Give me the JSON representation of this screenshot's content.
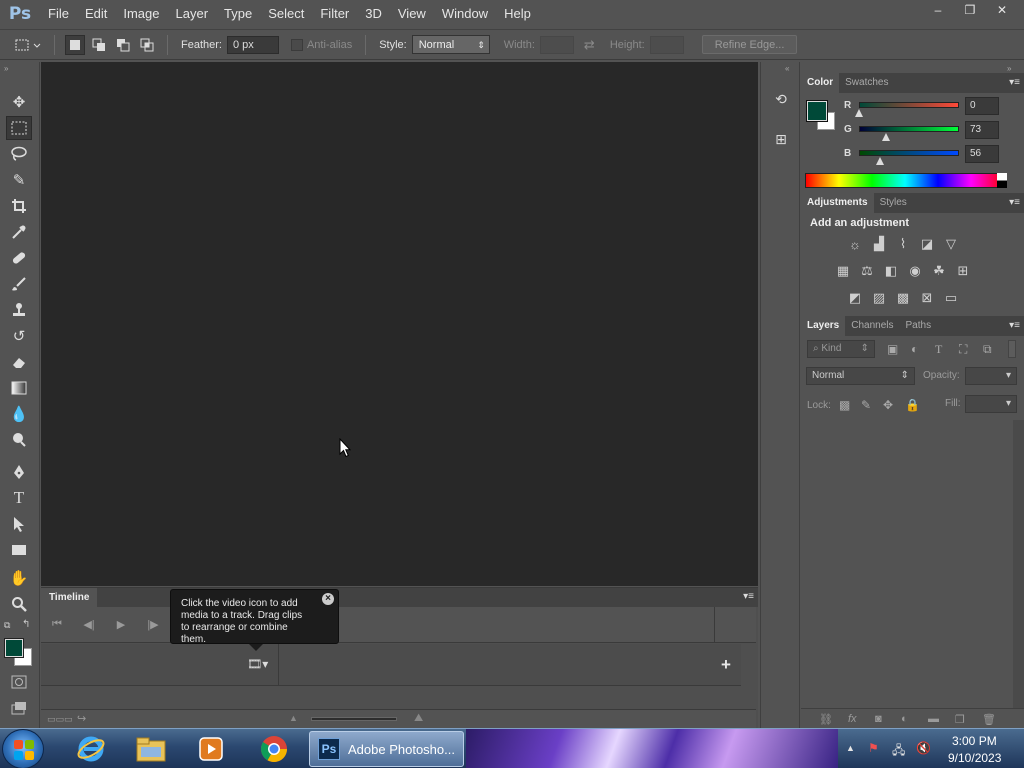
{
  "app": {
    "logo": "Ps"
  },
  "menu": [
    "File",
    "Edit",
    "Image",
    "Layer",
    "Type",
    "Select",
    "Filter",
    "3D",
    "View",
    "Window",
    "Help"
  ],
  "window_controls": {
    "minimize": "–",
    "restore": "❐",
    "close": "✕"
  },
  "options": {
    "feather_label": "Feather:",
    "feather_value": "0 px",
    "antialias_label": "Anti-alias",
    "style_label": "Style:",
    "style_value": "Normal",
    "width_label": "Width:",
    "height_label": "Height:",
    "refine_label": "Refine Edge..."
  },
  "colors": {
    "foreground": "#004938",
    "background": "#ffffff"
  },
  "timeline": {
    "tab": "Timeline",
    "tooltip": "Click the video icon to add media to a track. Drag clips to rearrange or combine them.",
    "add": "+"
  },
  "color_panel": {
    "tabs": [
      "Color",
      "Swatches"
    ],
    "r_label": "R",
    "r_value": "0",
    "g_label": "G",
    "g_value": "73",
    "b_label": "B",
    "b_value": "56"
  },
  "adjustments_panel": {
    "tabs": [
      "Adjustments",
      "Styles"
    ],
    "heading": "Add an adjustment"
  },
  "layers_panel": {
    "tabs": [
      "Layers",
      "Channels",
      "Paths"
    ],
    "kind_label": "Kind",
    "blend_mode": "Normal",
    "opacity_label": "Opacity:",
    "lock_label": "Lock:",
    "fill_label": "Fill:"
  },
  "taskbar": {
    "active_task": "Adobe Photosho...",
    "time": "3:00 PM",
    "date": "9/10/2023"
  }
}
